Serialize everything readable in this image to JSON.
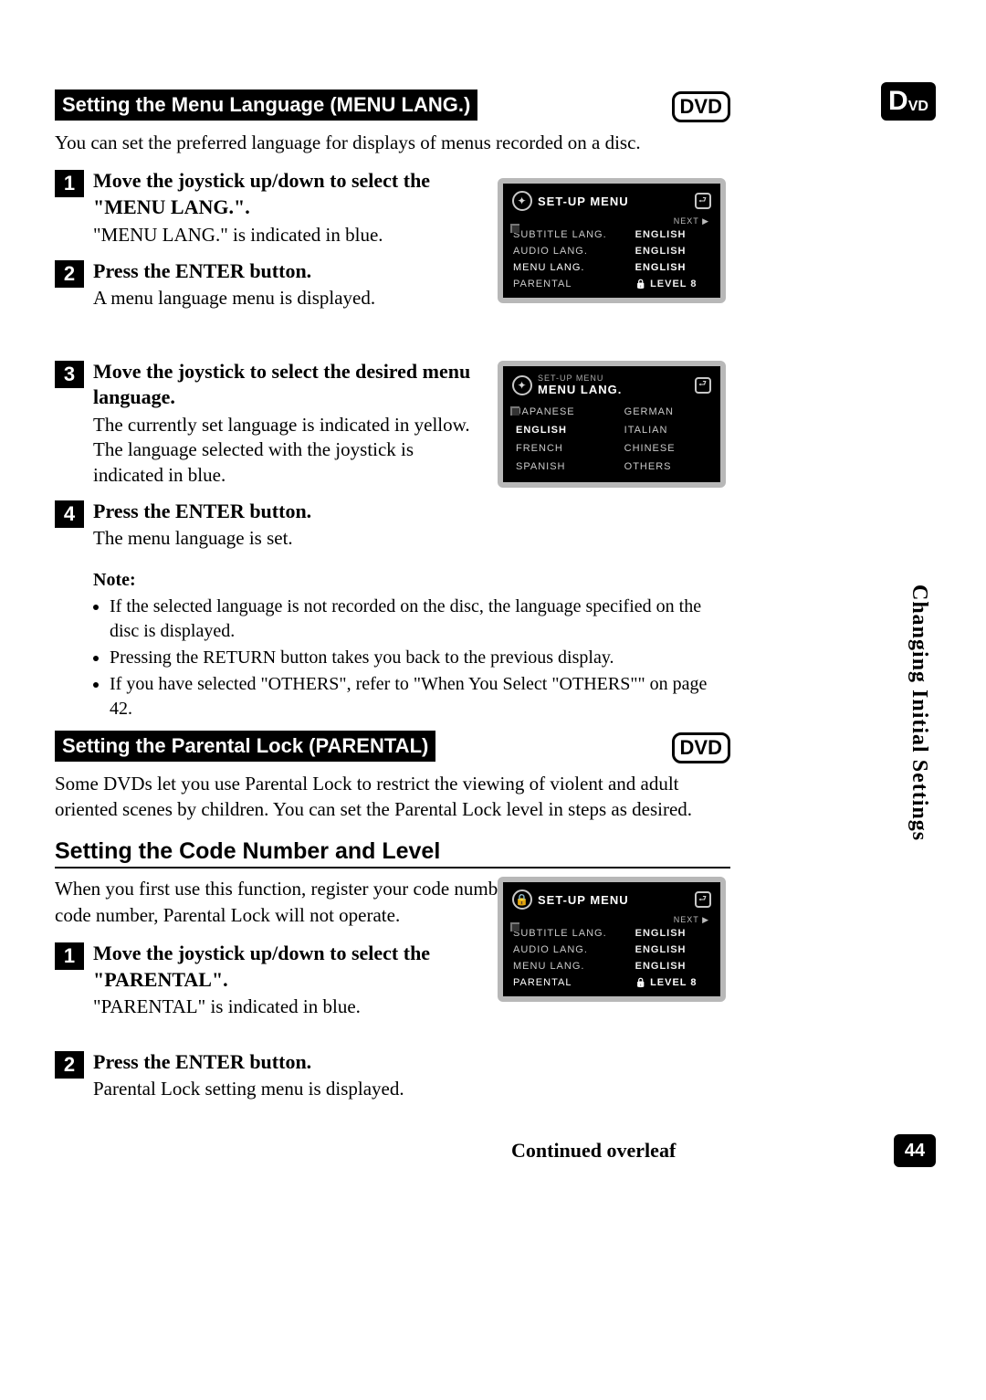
{
  "side_tab": {
    "main": "D",
    "sub": "VD"
  },
  "vertical_label": "Changing Initial Settings",
  "page_number": "44",
  "continued": "Continued overleaf",
  "dvd_badge": "DVD",
  "section1": {
    "title": "Setting the Menu Language (MENU LANG.)",
    "intro": "You can set the preferred language for displays of menus recorded on a disc.",
    "steps": [
      {
        "n": "1",
        "title": "Move the joystick up/down to select the \"MENU LANG.\".",
        "text": "\"MENU LANG.\" is indicated in blue."
      },
      {
        "n": "2",
        "title": "Press the ENTER button.",
        "text": "A menu language menu is displayed."
      },
      {
        "n": "3",
        "title": "Move the joystick to select the desired menu language.",
        "text": "The currently set language is indicated in yellow. The language selected with the joystick is indicated in blue."
      },
      {
        "n": "4",
        "title": "Press the ENTER button.",
        "text": "The menu language is set."
      }
    ],
    "note_title": "Note:",
    "notes": [
      "If the selected language is not recorded on the disc, the language specified on the disc is displayed.",
      "Pressing the RETURN button takes you back to the previous display.",
      "If you have selected \"OTHERS\", refer to \"When You Select \"OTHERS\"\" on page 42."
    ]
  },
  "section2": {
    "title": "Setting the Parental Lock (PARENTAL)",
    "intro": "Some DVDs let you use Parental Lock to restrict the viewing of violent and adult oriented scenes by children. You can set the Parental Lock level in steps as desired.",
    "subhead": "Setting the Code Number and Level",
    "subintro": "When you first use this function, register your code number. If you do not register a code number, Parental Lock will not operate.",
    "steps": [
      {
        "n": "1",
        "title": "Move the joystick up/down to select the \"PARENTAL\".",
        "text": "\"PARENTAL\" is indicated in blue."
      },
      {
        "n": "2",
        "title": "Press the ENTER button.",
        "text": "Parental Lock setting menu is displayed."
      }
    ]
  },
  "osd_setup": {
    "title": "SET-UP MENU",
    "next": "NEXT ▶",
    "rows": [
      {
        "label": "SUBTITLE LANG.",
        "value": "ENGLISH"
      },
      {
        "label": "AUDIO LANG.",
        "value": "ENGLISH"
      },
      {
        "label": "MENU LANG.",
        "value": "ENGLISH",
        "hl": true
      },
      {
        "label": "PARENTAL",
        "value": "LEVEL 8",
        "lock": true
      }
    ]
  },
  "osd_lang": {
    "super": "SET-UP MENU",
    "title": "MENU LANG.",
    "grid": [
      [
        "JAPANESE",
        "GERMAN"
      ],
      [
        "ENGLISH",
        "ITALIAN"
      ],
      [
        "FRENCH",
        "CHINESE"
      ],
      [
        "SPANISH",
        "OTHERS"
      ]
    ],
    "selected": "ENGLISH"
  },
  "osd_parental": {
    "title": "SET-UP MENU",
    "next": "NEXT ▶",
    "rows": [
      {
        "label": "SUBTITLE LANG.",
        "value": "ENGLISH"
      },
      {
        "label": "AUDIO LANG.",
        "value": "ENGLISH"
      },
      {
        "label": "MENU LANG.",
        "value": "ENGLISH"
      },
      {
        "label": "PARENTAL",
        "value": "LEVEL 8",
        "lock": true,
        "hl": true
      }
    ]
  }
}
